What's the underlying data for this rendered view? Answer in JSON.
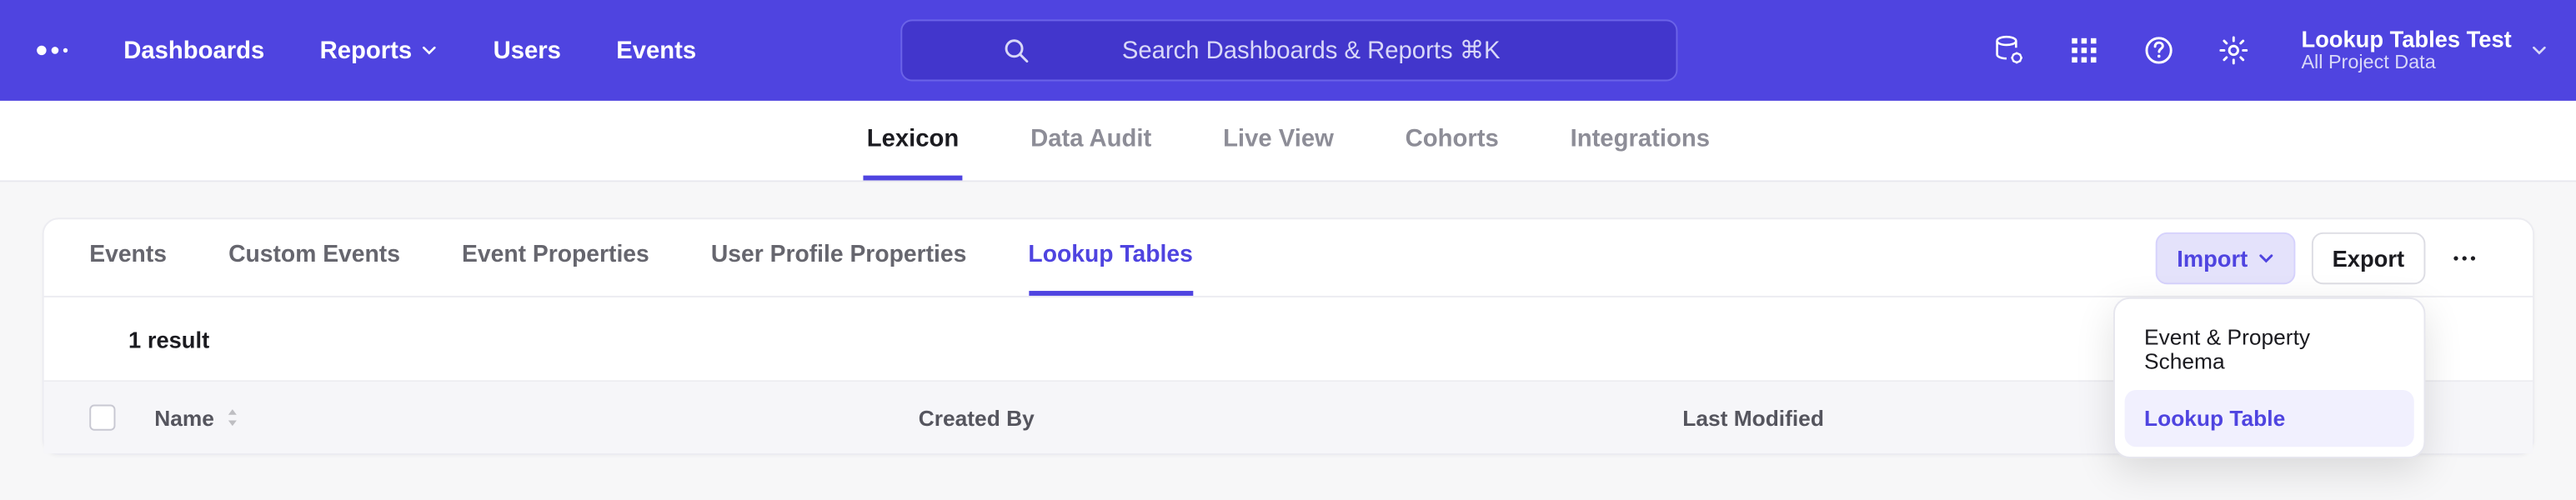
{
  "topnav": {
    "items": [
      {
        "label": "Dashboards"
      },
      {
        "label": "Reports",
        "hasDropdown": true
      },
      {
        "label": "Users"
      },
      {
        "label": "Events"
      }
    ],
    "search_placeholder": "Search Dashboards & Reports ⌘K",
    "project": {
      "title": "Lookup Tables Test",
      "subtitle": "All Project Data"
    }
  },
  "subnav": {
    "tabs": [
      {
        "label": "Lexicon",
        "active": true
      },
      {
        "label": "Data Audit"
      },
      {
        "label": "Live View"
      },
      {
        "label": "Cohorts"
      },
      {
        "label": "Integrations"
      }
    ]
  },
  "lexicon": {
    "tabs": [
      {
        "label": "Events"
      },
      {
        "label": "Custom Events"
      },
      {
        "label": "Event Properties"
      },
      {
        "label": "User Profile Properties"
      },
      {
        "label": "Lookup Tables",
        "active": true
      }
    ],
    "import_label": "Import",
    "export_label": "Export",
    "import_menu": [
      {
        "label": "Event & Property Schema"
      },
      {
        "label": "Lookup Table",
        "highlight": true
      }
    ],
    "result_count_text": "1 result",
    "columns": {
      "name": "Name",
      "created_by": "Created By",
      "last_modified": "Last Modified"
    }
  }
}
